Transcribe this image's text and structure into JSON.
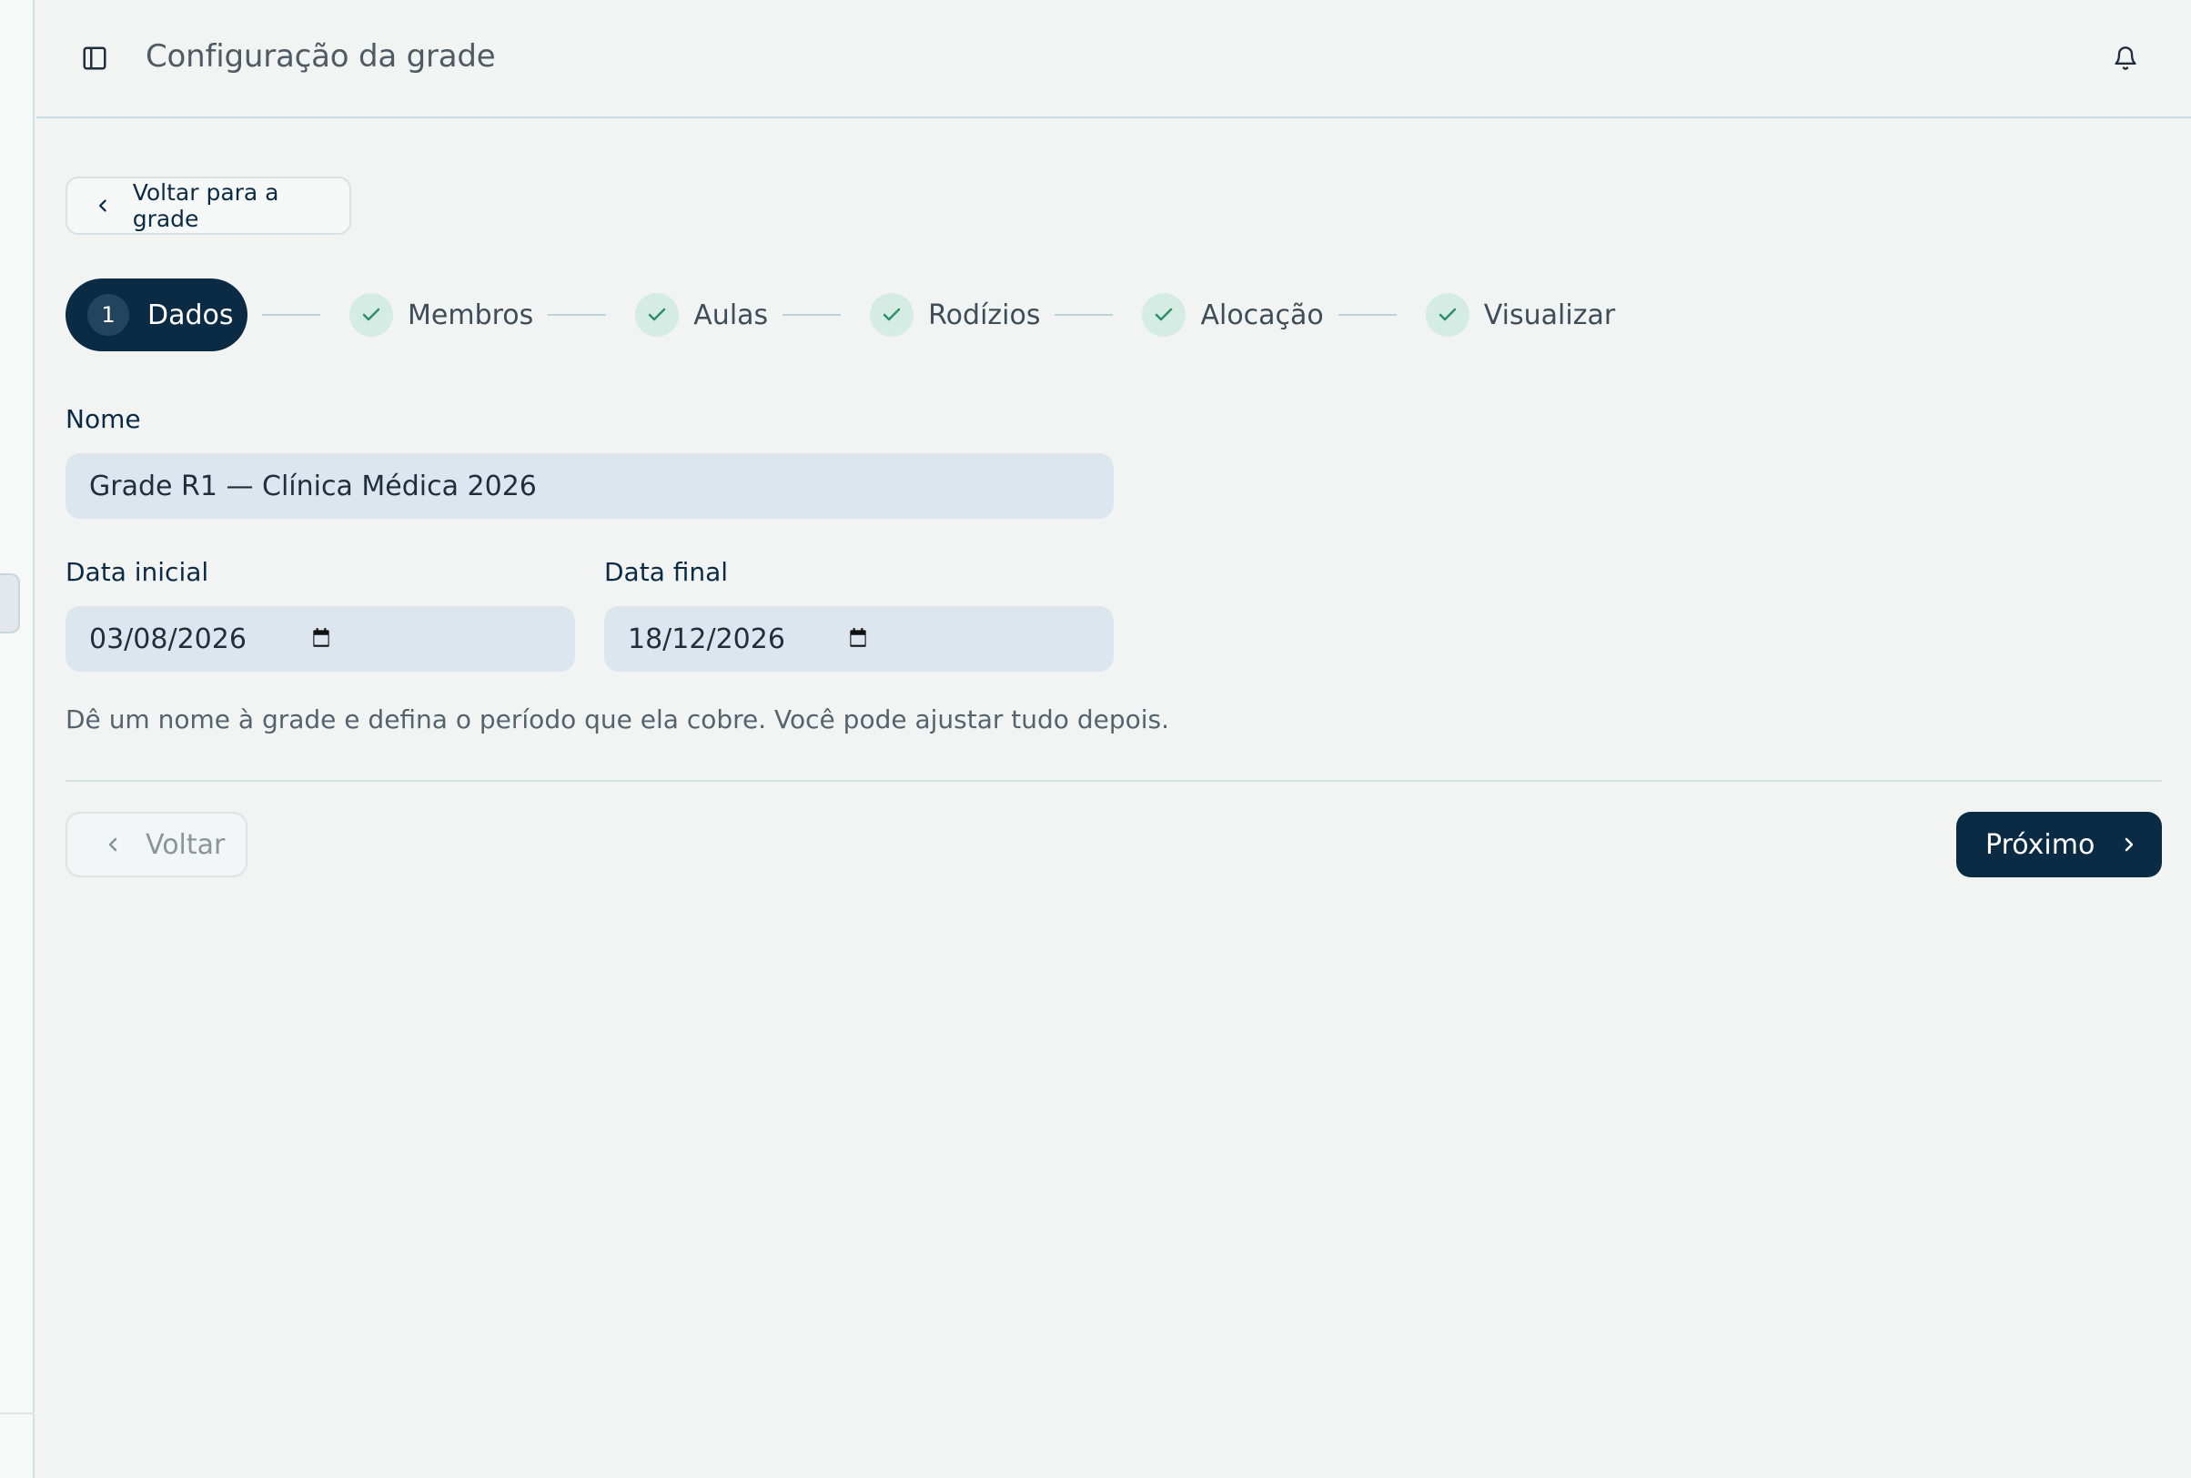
{
  "header": {
    "title": "Configuração da grade"
  },
  "nav": {
    "back_to_grid_label": "Voltar para a grade"
  },
  "stepper": {
    "active": {
      "number": "1",
      "label": "Dados"
    },
    "steps": [
      {
        "label": "Membros",
        "status": "complete"
      },
      {
        "label": "Aulas",
        "status": "complete"
      },
      {
        "label": "Rodízios",
        "status": "complete"
      },
      {
        "label": "Alocação",
        "status": "complete"
      },
      {
        "label": "Visualizar",
        "status": "complete"
      }
    ]
  },
  "form": {
    "name_label": "Nome",
    "name_value": "Grade R1 — Clínica Médica 2026",
    "start_label": "Data inicial",
    "start_value": "03/08/2026",
    "end_label": "Data final",
    "end_value": "18/12/2026",
    "hint": "Dê um nome à grade e defina o período que ela cobre. Você pode ajustar tudo depois."
  },
  "footer": {
    "back_label": "Voltar",
    "next_label": "Próximo"
  },
  "colors": {
    "primary": "#0b2a44",
    "check_bg": "#d4ece3",
    "check_fg": "#2f8f68",
    "input_bg": "#dde6ef",
    "page_bg": "#f1f4f3"
  },
  "icons": [
    "sidebar-toggle-icon",
    "bell-icon",
    "chevron-left-icon",
    "check-icon",
    "calendar-icon",
    "chevron-right-icon"
  ]
}
